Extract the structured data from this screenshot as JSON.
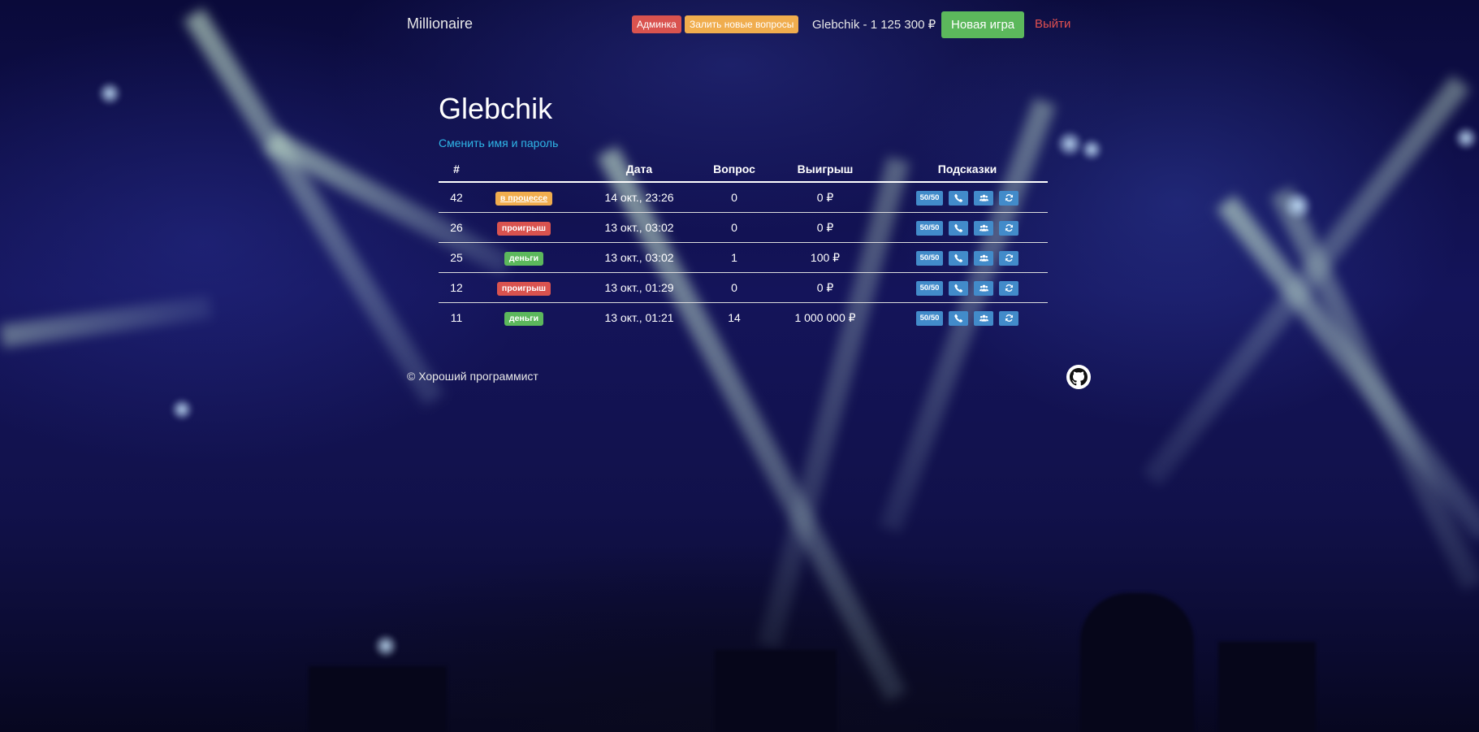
{
  "navbar": {
    "brand": "Millionaire",
    "admin_label": "Админка",
    "upload_label": "Залить новые вопросы",
    "user_balance": "Glebchik - 1 125 300 ₽",
    "new_game_label": "Новая игра",
    "logout_label": "Выйти"
  },
  "profile": {
    "name": "Glebchik",
    "change_link": "Сменить имя и пароль"
  },
  "table": {
    "headers": [
      "#",
      "",
      "Дата",
      "Вопрос",
      "Выигрыш",
      "Подсказки"
    ],
    "rows": [
      {
        "id": "42",
        "status": "в процессе",
        "status_kind": "warning",
        "date": "14 окт., 23:26",
        "question": "0",
        "prize": "0 ₽"
      },
      {
        "id": "26",
        "status": "проигрыш",
        "status_kind": "danger",
        "date": "13 окт., 03:02",
        "question": "0",
        "prize": "0 ₽"
      },
      {
        "id": "25",
        "status": "деньги",
        "status_kind": "success",
        "date": "13 окт., 03:02",
        "question": "1",
        "prize": "100 ₽"
      },
      {
        "id": "12",
        "status": "проигрыш",
        "status_kind": "danger",
        "date": "13 окт., 01:29",
        "question": "0",
        "prize": "0 ₽"
      },
      {
        "id": "11",
        "status": "деньги",
        "status_kind": "success",
        "date": "13 окт., 01:21",
        "question": "14",
        "prize": "1 000 000 ₽"
      }
    ],
    "hints": {
      "fifty_fifty": "50/50",
      "phone_icon": "phone-icon",
      "audience_icon": "audience-icon",
      "switch_icon": "refresh-icon"
    }
  },
  "footer": {
    "copyright": "© Хороший программист",
    "github_icon": "github-icon"
  },
  "colors": {
    "background": "#0b0b3a",
    "success": "#5cb85c",
    "danger": "#d9534f",
    "warning": "#f0ad4e",
    "primary": "#428bca",
    "link": "#2fb7e9"
  }
}
